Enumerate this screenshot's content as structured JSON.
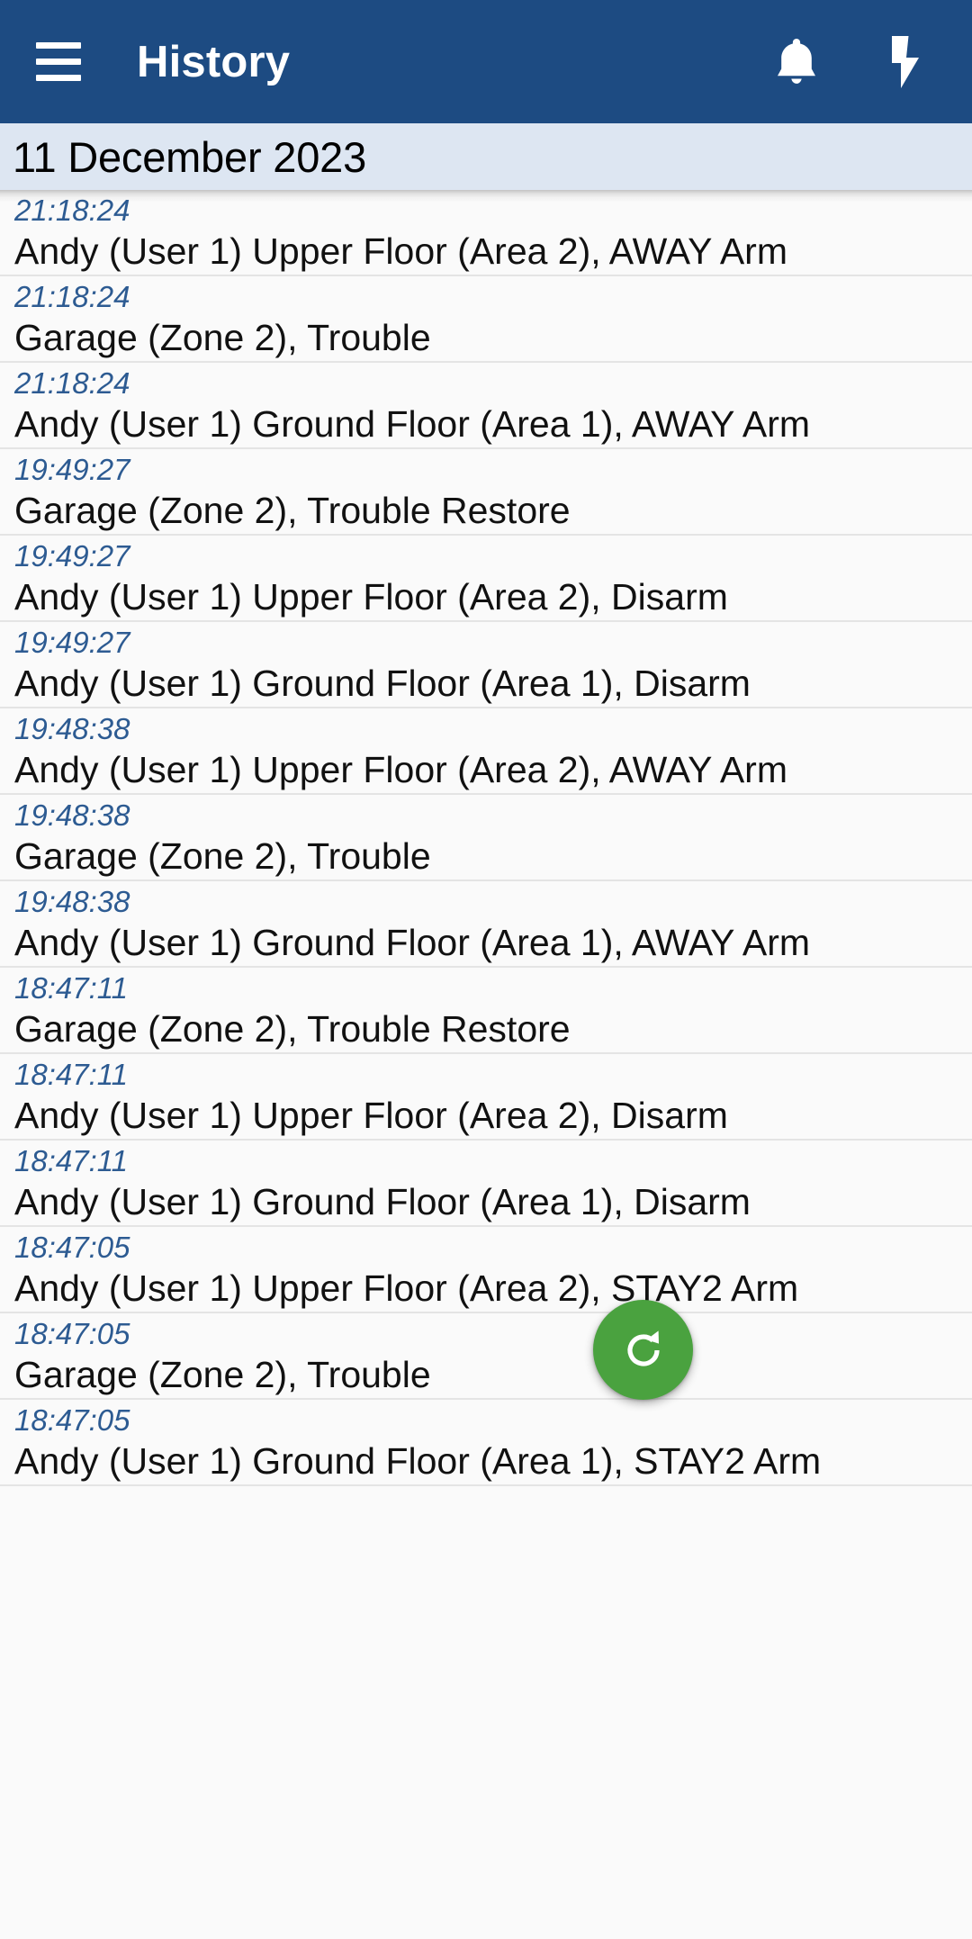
{
  "appbar": {
    "title": "History",
    "menu_icon": "hamburger-menu-icon",
    "notifications_icon": "bell-icon",
    "panic_icon": "lightning-bolt-icon",
    "background_color": "#1d4b82",
    "foreground_color": "#ffffff"
  },
  "date_header": {
    "label": "11 December 2023",
    "background_color": "#dde6f2",
    "text_color": "#000000"
  },
  "list": {
    "time_color": "#2d5b92",
    "description_color": "#111111",
    "row_background": "#fafafa",
    "divider_color": "#e4e4e4",
    "events": [
      {
        "time": "21:18:24",
        "description": "Andy (User 1) Upper Floor (Area 2), AWAY Arm"
      },
      {
        "time": "21:18:24",
        "description": "Garage (Zone 2), Trouble"
      },
      {
        "time": "21:18:24",
        "description": "Andy (User 1) Ground Floor (Area 1), AWAY Arm"
      },
      {
        "time": "19:49:27",
        "description": "Garage (Zone 2), Trouble Restore"
      },
      {
        "time": "19:49:27",
        "description": "Andy (User 1) Upper Floor (Area 2), Disarm"
      },
      {
        "time": "19:49:27",
        "description": "Andy (User 1) Ground Floor (Area 1), Disarm"
      },
      {
        "time": "19:48:38",
        "description": "Andy (User 1) Upper Floor (Area 2), AWAY Arm"
      },
      {
        "time": "19:48:38",
        "description": "Garage (Zone 2), Trouble"
      },
      {
        "time": "19:48:38",
        "description": "Andy (User 1) Ground Floor (Area 1), AWAY Arm"
      },
      {
        "time": "18:47:11",
        "description": "Garage (Zone 2), Trouble Restore"
      },
      {
        "time": "18:47:11",
        "description": "Andy (User 1) Upper Floor (Area 2), Disarm"
      },
      {
        "time": "18:47:11",
        "description": "Andy (User 1) Ground Floor (Area 1), Disarm"
      },
      {
        "time": "18:47:05",
        "description": "Andy (User 1) Upper Floor (Area 2), STAY2 Arm"
      },
      {
        "time": "18:47:05",
        "description": "Garage (Zone 2), Trouble"
      },
      {
        "time": "18:47:05",
        "description": "Andy (User 1) Ground Floor (Area 1), STAY2 Arm"
      }
    ]
  },
  "fab": {
    "icon": "refresh-icon",
    "color": "#4aa23f",
    "icon_color": "#ffffff"
  }
}
